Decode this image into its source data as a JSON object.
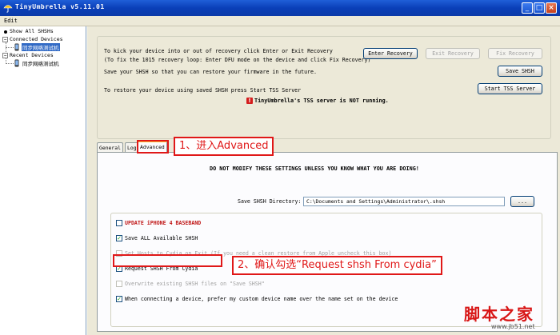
{
  "window": {
    "title": "TinyUmbrella v5.11.01",
    "controls": {
      "minimize": "_",
      "maximize": "□",
      "close": "×"
    }
  },
  "menu": {
    "items": [
      "Edit"
    ]
  },
  "sidebar": {
    "show_all": "Show All SHSHs",
    "connected_header": "Connected Devices",
    "connected_device": "同步网络测试机",
    "recent_header": "Recent Devices",
    "recent_device": "同步网络测试机",
    "expand_glyph": "−"
  },
  "main": {
    "messages": {
      "recovery": "To kick your device into or out of recovery click Enter or Exit Recovery",
      "fix": "(To fix the 1015 recovery loop: Enter DFU mode on the device and click Fix Recovery)",
      "save": "Save your SHSH so that you can restore your firmware in the future.",
      "restore": "To restore your device using saved SHSH press Start TSS Server"
    },
    "buttons": {
      "enter_recovery": "Enter Recovery",
      "exit_recovery": "Exit Recovery",
      "fix_recovery": "Fix Recovery",
      "save_shsh": "Save SHSH",
      "start_tss": "Start TSS Server"
    },
    "status": {
      "icon": "!",
      "text": "TinyUmbrella's TSS server is NOT running."
    }
  },
  "tabs": {
    "general": "General",
    "log": "Log",
    "advanced": "Advanced"
  },
  "advanced": {
    "warning": "DO NOT MODIFY THESE SETTINGS UNLESS YOU KNOW WHAT YOU ARE DOING!",
    "dir_label": "Save SHSH Directory:",
    "dir_value": "C:\\Documents and Settings\\Administrator\\.shsh",
    "browse": "...",
    "options": [
      {
        "label": "UPDATE iPHONE 4 BASEBAND",
        "checked": false
      },
      {
        "label": "Save ALL Available SHSH",
        "checked": true
      },
      {
        "label": "Set Hosts to Cydia on Exit (If you need a clean restore from Apple uncheck this box)",
        "checked": false
      },
      {
        "label": "Request SHSH From Cydia",
        "checked": true
      },
      {
        "label": "Overwrite existing SHSH files on \"Save SHSH\"",
        "checked": false
      },
      {
        "label": "When connecting a device, prefer my custom device name over the name set on the device",
        "checked": true
      }
    ],
    "check_glyph": "✓"
  },
  "annotations": {
    "step1": "1、进入Advanced",
    "step2": "2、确认勾选“Request shsh From cydia”",
    "color": "#e01818"
  },
  "watermark": {
    "chinese": "脚本之家",
    "url": "www.jb51.net"
  }
}
